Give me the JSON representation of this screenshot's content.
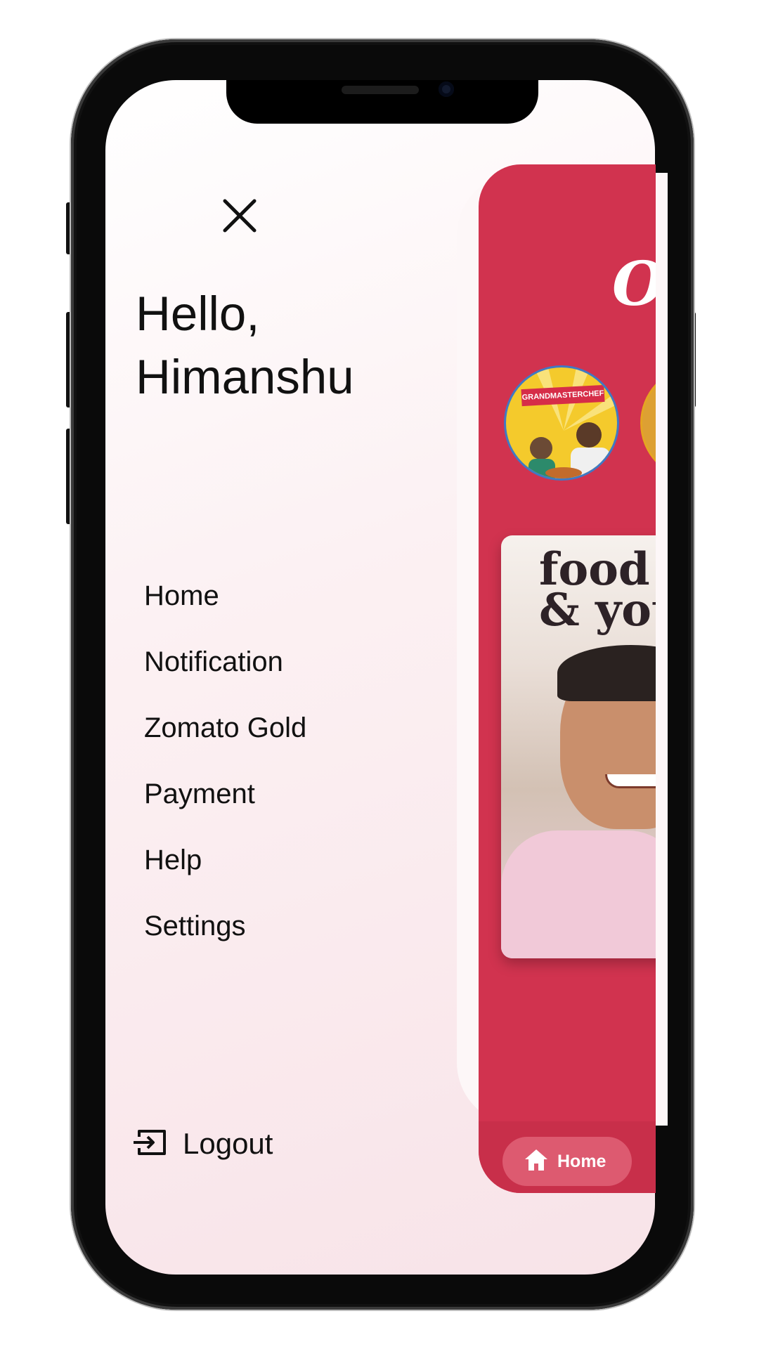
{
  "drawer": {
    "greeting_line1": "Hello,",
    "greeting_line2": "Himanshu",
    "menu": [
      {
        "label": "Home"
      },
      {
        "label": "Notification"
      },
      {
        "label": "Zomato Gold"
      },
      {
        "label": "Payment"
      },
      {
        "label": "Help"
      },
      {
        "label": "Settings"
      }
    ],
    "logout_label": "Logout",
    "icons": {
      "close": "close-icon",
      "logout": "logout-icon"
    }
  },
  "app_preview": {
    "brand_text": "Os",
    "stories": [
      {
        "banner": "GRANDMASTERCHEF"
      },
      {
        "banner": ""
      }
    ],
    "promo": {
      "title_line1": "food",
      "title_line2": "& you"
    },
    "bottom_nav": {
      "home_label": "Home",
      "icon": "home-icon"
    }
  },
  "colors": {
    "accent": "#d1334f",
    "drawer_bg": "#fcf1f3",
    "text": "#111111",
    "home_pill": "#dd5a70"
  }
}
